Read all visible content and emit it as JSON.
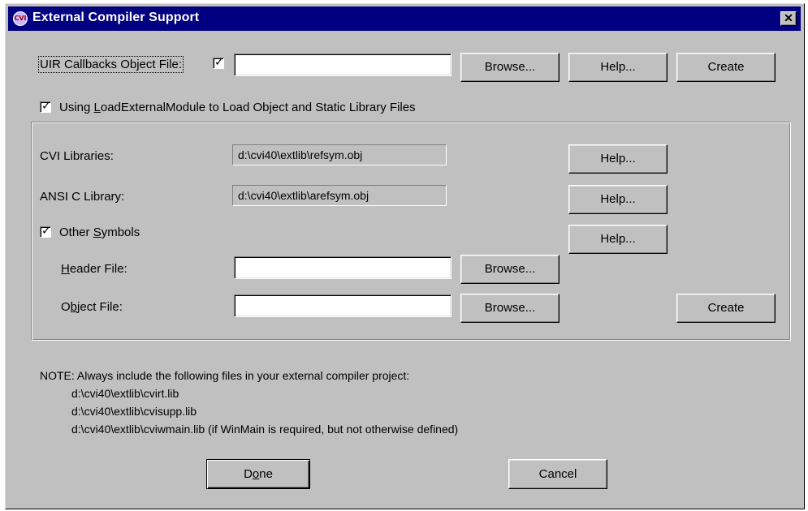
{
  "window": {
    "title": "External Compiler Support",
    "app_icon_text": "CVI",
    "close_glyph": "✕"
  },
  "uir": {
    "label": "UIR Callbacks Object File:",
    "checked": true,
    "value": "",
    "browse_label": "Browse...",
    "help_label": "Help...",
    "create_label": "Create"
  },
  "load_external": {
    "checked": true,
    "label_prefix": "Using ",
    "label_mnemonic": "L",
    "label_rest": "oadExternalModule to Load Object and Static Library Files"
  },
  "group": {
    "cvi_libraries": {
      "label": "CVI Libraries:",
      "value": "d:\\cvi40\\extlib\\refsym.obj",
      "help_label": "Help..."
    },
    "ansi_c": {
      "label": "ANSI C Library:",
      "value": "d:\\cvi40\\extlib\\arefsym.obj",
      "help_label": "Help..."
    },
    "other_symbols": {
      "checked": true,
      "label_prefix": "Other ",
      "label_mnemonic": "S",
      "label_rest": "ymbols",
      "help_label": "Help..."
    },
    "header_file": {
      "label_mnemonic": "H",
      "label_rest": "eader File:",
      "value": "",
      "browse_label": "Browse..."
    },
    "object_file": {
      "label_prefix": "O",
      "label_mnemonic": "b",
      "label_rest": "ject File:",
      "value": "",
      "browse_label": "Browse..."
    },
    "create_label": "Create"
  },
  "note": {
    "heading": "NOTE: Always include the following files in your external compiler project:",
    "files": [
      "d:\\cvi40\\extlib\\cvirt.lib",
      "d:\\cvi40\\extlib\\cvisupp.lib",
      "d:\\cvi40\\extlib\\cviwmain.lib (if WinMain is required, but not otherwise defined)"
    ]
  },
  "footer": {
    "done_prefix": "D",
    "done_mnemonic": "o",
    "done_rest": "ne",
    "cancel_label": "Cancel"
  }
}
